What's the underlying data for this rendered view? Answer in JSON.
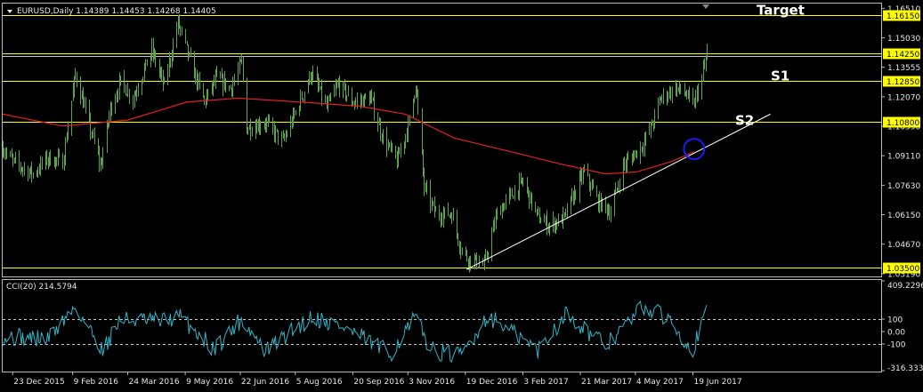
{
  "chart_data": {
    "type": "candlestick",
    "symbol_header": "EURUSD,Daily  1.14389 1.14453 1.14268 1.14405",
    "price_axis_ticks": [
      "1.16510",
      "1.15030",
      "1.13555",
      "1.12070",
      "1.10590",
      "1.09110",
      "1.07630",
      "1.06150",
      "1.04670",
      "1.03190"
    ],
    "ylim": [
      1.0305,
      1.1675
    ],
    "date_ticks": [
      "23 Dec 2015",
      "9 Feb 2016",
      "24 Mar 2016",
      "9 May 2016",
      "22 Jun 2016",
      "5 Aug 2016",
      "20 Sep 2016",
      "3 Nov 2016",
      "19 Dec 2016",
      "3 Feb 2017",
      "21 Mar 2017",
      "4 May 2017",
      "19 Jun 2017"
    ],
    "close_series": [
      [
        "2015-12-15",
        1.095
      ],
      [
        "2015-12-23",
        1.088
      ],
      [
        "2016-01-08",
        1.082
      ],
      [
        "2016-01-20",
        1.09
      ],
      [
        "2016-02-01",
        1.088
      ],
      [
        "2016-02-11",
        1.132
      ],
      [
        "2016-02-24",
        1.102
      ],
      [
        "2016-03-02",
        1.086
      ],
      [
        "2016-03-10",
        1.115
      ],
      [
        "2016-03-18",
        1.128
      ],
      [
        "2016-03-28",
        1.12
      ],
      [
        "2016-04-12",
        1.144
      ],
      [
        "2016-04-22",
        1.126
      ],
      [
        "2016-05-03",
        1.158
      ],
      [
        "2016-05-12",
        1.14
      ],
      [
        "2016-05-24",
        1.118
      ],
      [
        "2016-06-03",
        1.13
      ],
      [
        "2016-06-14",
        1.125
      ],
      [
        "2016-06-23",
        1.138
      ],
      [
        "2016-06-27",
        1.105
      ],
      [
        "2016-07-12",
        1.108
      ],
      [
        "2016-07-26",
        1.098
      ],
      [
        "2016-08-05",
        1.113
      ],
      [
        "2016-08-18",
        1.133
      ],
      [
        "2016-08-30",
        1.115
      ],
      [
        "2016-09-08",
        1.127
      ],
      [
        "2016-09-20",
        1.118
      ],
      [
        "2016-10-04",
        1.12
      ],
      [
        "2016-10-14",
        1.1
      ],
      [
        "2016-10-25",
        1.088
      ],
      [
        "2016-11-04",
        1.108
      ],
      [
        "2016-11-09",
        1.128
      ],
      [
        "2016-11-16",
        1.075
      ],
      [
        "2016-11-25",
        1.062
      ],
      [
        "2016-12-08",
        1.062
      ],
      [
        "2016-12-15",
        1.045
      ],
      [
        "2016-12-20",
        1.04
      ],
      [
        "2017-01-03",
        1.036
      ],
      [
        "2017-01-13",
        1.062
      ],
      [
        "2017-01-24",
        1.071
      ],
      [
        "2017-02-03",
        1.078
      ],
      [
        "2017-02-15",
        1.06
      ],
      [
        "2017-02-24",
        1.056
      ],
      [
        "2017-03-08",
        1.06
      ],
      [
        "2017-03-20",
        1.078
      ],
      [
        "2017-03-24",
        1.083
      ],
      [
        "2017-04-04",
        1.068
      ],
      [
        "2017-04-14",
        1.063
      ],
      [
        "2017-04-24",
        1.086
      ],
      [
        "2017-05-08",
        1.095
      ],
      [
        "2017-05-16",
        1.105
      ],
      [
        "2017-05-24",
        1.12
      ],
      [
        "2017-06-05",
        1.125
      ],
      [
        "2017-06-12",
        1.123
      ],
      [
        "2017-06-19",
        1.116
      ],
      [
        "2017-06-26",
        1.13
      ],
      [
        "2017-06-30",
        1.1425
      ]
    ],
    "moving_average": [
      [
        "2015-12-15",
        1.112
      ],
      [
        "2016-02-01",
        1.106
      ],
      [
        "2016-03-24",
        1.109
      ],
      [
        "2016-05-10",
        1.118
      ],
      [
        "2016-06-20",
        1.12
      ],
      [
        "2016-08-10",
        1.118
      ],
      [
        "2016-09-25",
        1.116
      ],
      [
        "2016-11-01",
        1.112
      ],
      [
        "2016-12-10",
        1.1
      ],
      [
        "2017-01-25",
        1.093
      ],
      [
        "2017-03-05",
        1.087
      ],
      [
        "2017-04-10",
        1.082
      ],
      [
        "2017-05-05",
        1.083
      ],
      [
        "2017-06-01",
        1.088
      ],
      [
        "2017-06-20",
        1.093
      ]
    ],
    "horizontal_levels": [
      {
        "label": "1.16150",
        "price": 1.1615,
        "annotation": "Target"
      },
      {
        "label": "1.14250",
        "price": 1.1425,
        "annotation": ""
      },
      {
        "label": "1.12850",
        "price": 1.1285,
        "annotation": "S1"
      },
      {
        "label": "1.10800",
        "price": 1.108,
        "annotation": "S2"
      },
      {
        "label": "1.03500",
        "price": 1.035,
        "annotation": ""
      }
    ],
    "trendline": {
      "from": [
        "2016-12-20",
        1.034
      ],
      "to": [
        "2017-08-20",
        1.112
      ]
    },
    "circle_marker": [
      "2017-06-20",
      1.0945
    ],
    "cci": {
      "title": "CCI(20) 214.5794",
      "axis_ticks": [
        "409.2296",
        "100",
        "0.00",
        "-100",
        "-316.3336"
      ],
      "ylim": [
        -316.3336,
        409.2296
      ],
      "levels": [
        100,
        -100
      ],
      "values": [
        [
          "2015-12-15",
          -40
        ],
        [
          "2016-01-20",
          -60
        ],
        [
          "2016-02-11",
          200
        ],
        [
          "2016-03-04",
          -150
        ],
        [
          "2016-03-18",
          100
        ],
        [
          "2016-04-18",
          80
        ],
        [
          "2016-05-05",
          120
        ],
        [
          "2016-06-01",
          -140
        ],
        [
          "2016-06-23",
          100
        ],
        [
          "2016-07-12",
          -160
        ],
        [
          "2016-08-18",
          120
        ],
        [
          "2016-09-12",
          40
        ],
        [
          "2016-10-20",
          -180
        ],
        [
          "2016-11-09",
          110
        ],
        [
          "2016-11-22",
          -150
        ],
        [
          "2016-12-15",
          -200
        ],
        [
          "2017-01-06",
          130
        ],
        [
          "2017-02-15",
          -150
        ],
        [
          "2017-03-10",
          150
        ],
        [
          "2017-04-10",
          -120
        ],
        [
          "2017-05-10",
          200
        ],
        [
          "2017-06-01",
          100
        ],
        [
          "2017-06-19",
          -150
        ],
        [
          "2017-06-30",
          214.5794
        ]
      ]
    },
    "colors": {
      "candle": "#5aa54a",
      "moving_average": "#e02020",
      "level_line": "#ffff00",
      "badge_fill": "#ffff00",
      "trendline": "#ffffff",
      "circle": "#1a1aff",
      "cci_line": "#2fb5c8",
      "cci_level": "#c8c8c8",
      "background": "#000000",
      "text": "#e6e6e6",
      "frame": "#b8b8b8"
    }
  }
}
